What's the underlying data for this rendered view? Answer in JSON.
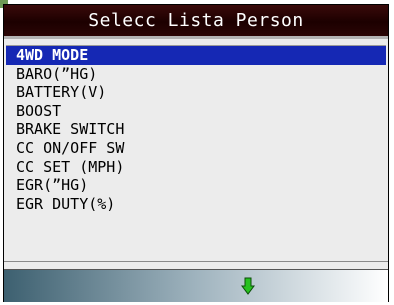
{
  "title": "Selecc Lista Person",
  "list": {
    "items": [
      {
        "label": "4WD MODE",
        "selected": true
      },
      {
        "label": "BARO(”HG)",
        "selected": false
      },
      {
        "label": "BATTERY(V)",
        "selected": false
      },
      {
        "label": "BOOST",
        "selected": false
      },
      {
        "label": "BRAKE SWITCH",
        "selected": false
      },
      {
        "label": "CC ON/OFF SW",
        "selected": false
      },
      {
        "label": "CC SET (MPH)",
        "selected": false
      },
      {
        "label": "EGR(”HG)",
        "selected": false
      },
      {
        "label": "EGR DUTY(%)",
        "selected": false
      }
    ]
  },
  "footer": {
    "scroll_icon": "arrow-down-icon",
    "arrow_color": "#27c21f"
  },
  "colors": {
    "highlight": "#1528b4",
    "title_bar": "#1c0000"
  }
}
